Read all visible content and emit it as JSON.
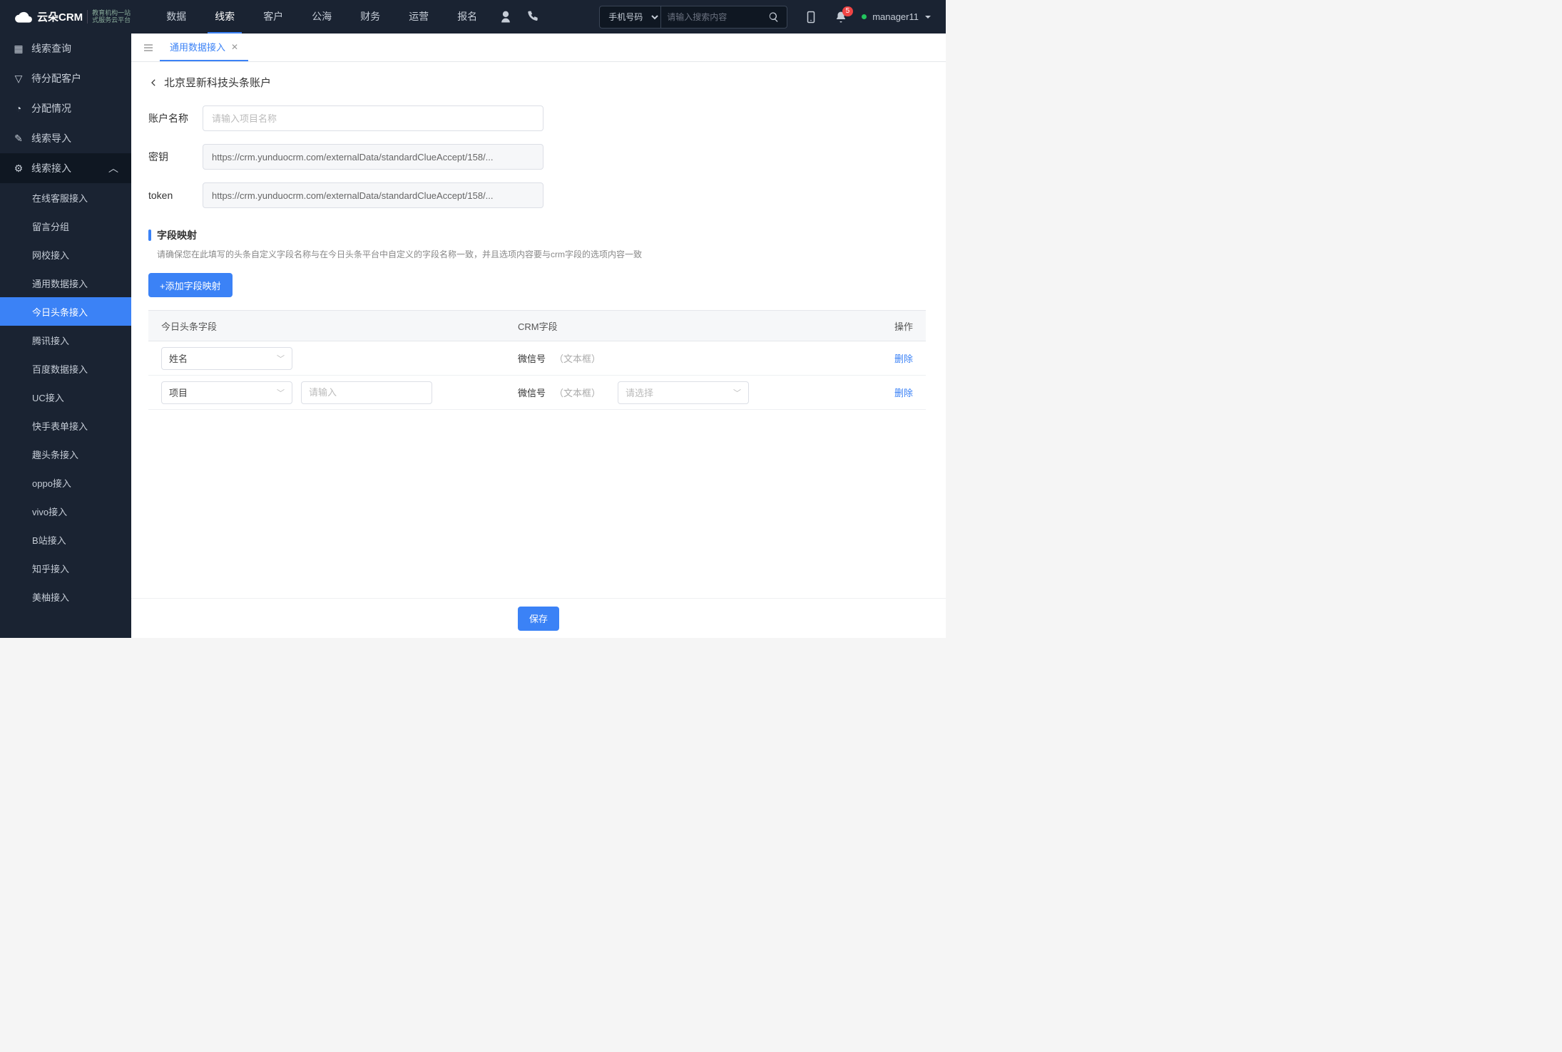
{
  "topnav": {
    "logo_text": "云朵CRM",
    "logo_sub1": "教育机构一站",
    "logo_sub2": "式服务云平台",
    "items": [
      "数据",
      "线索",
      "客户",
      "公海",
      "财务",
      "运营",
      "报名"
    ],
    "active_index": 1,
    "search_select": "手机号码",
    "search_placeholder": "请输入搜索内容",
    "badge_count": "5",
    "username": "manager11"
  },
  "sidebar": {
    "items": [
      {
        "label": "线索查询"
      },
      {
        "label": "待分配客户"
      },
      {
        "label": "分配情况"
      },
      {
        "label": "线索导入"
      },
      {
        "label": "线索接入",
        "expanded": true,
        "children": [
          {
            "label": "在线客服接入"
          },
          {
            "label": "留言分组"
          },
          {
            "label": "网校接入"
          },
          {
            "label": "通用数据接入"
          },
          {
            "label": "今日头条接入",
            "active": true
          },
          {
            "label": "腾讯接入"
          },
          {
            "label": "百度数据接入"
          },
          {
            "label": "UC接入"
          },
          {
            "label": "快手表单接入"
          },
          {
            "label": "趣头条接入"
          },
          {
            "label": "oppo接入"
          },
          {
            "label": "vivo接入"
          },
          {
            "label": "B站接入"
          },
          {
            "label": "知乎接入"
          },
          {
            "label": "美柚接入"
          }
        ]
      }
    ]
  },
  "tabs": {
    "items": [
      {
        "label": "通用数据接入",
        "active": true
      }
    ]
  },
  "page": {
    "breadcrumb": "北京昱新科技头条账户",
    "form": {
      "account_label": "账户名称",
      "account_placeholder": "请输入项目名称",
      "secret_label": "密钥",
      "secret_value": "https://crm.yunduocrm.com/externalData/standardClueAccept/158/...",
      "token_label": "token",
      "token_value": "https://crm.yunduocrm.com/externalData/standardClueAccept/158/..."
    },
    "section_title": "字段映射",
    "section_desc": "请确保您在此填写的头条自定义字段名称与在今日头条平台中自定义的字段名称一致，并且选项内容要与crm字段的选项内容一致",
    "add_btn": "+添加字段映射",
    "table": {
      "cols": [
        "今日头条字段",
        "CRM字段",
        "操作"
      ],
      "rows": [
        {
          "toutiao": "姓名",
          "crm_name": "微信号",
          "crm_note": "（文本框）",
          "delete": "删除",
          "extra": false
        },
        {
          "toutiao": "项目",
          "input_ph": "请输入",
          "crm_name": "微信号",
          "crm_note": "（文本框）",
          "select_ph": "请选择",
          "delete": "删除",
          "extra": true
        }
      ]
    },
    "save_btn": "保存"
  }
}
